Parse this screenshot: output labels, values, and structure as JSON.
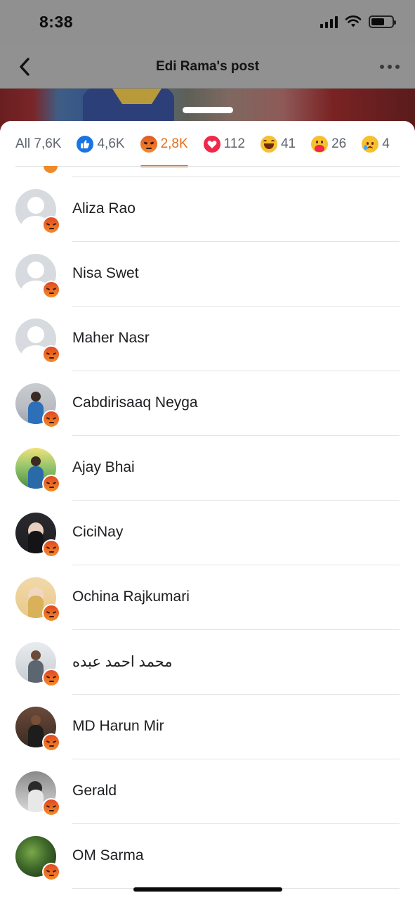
{
  "status_bar": {
    "time": "8:38",
    "icons": [
      "cellular-signal-icon",
      "wifi-icon",
      "battery-icon"
    ]
  },
  "header": {
    "title": "Edi Rama's post",
    "back_icon": "chevron-left-icon",
    "more_icon": "ellipsis-icon"
  },
  "tabs": [
    {
      "label": "All 7,6K",
      "icon": null,
      "active": false
    },
    {
      "label": "4,6K",
      "icon": "like-icon",
      "active": false
    },
    {
      "label": "2,8K",
      "icon": "angry-icon",
      "active": true
    },
    {
      "label": "112",
      "icon": "love-icon",
      "active": false
    },
    {
      "label": "41",
      "icon": "haha-icon",
      "active": false
    },
    {
      "label": "26",
      "icon": "care-icon",
      "active": false
    },
    {
      "label": "4",
      "icon": "sad-icon",
      "active": false
    }
  ],
  "colors": {
    "accent": "#e46d1c",
    "like": "#1b74e4",
    "love": "#f0284a",
    "text": "#1c1e21",
    "muted": "#5f656e"
  },
  "people": [
    {
      "name": "Aliza Rao",
      "avatar": "default"
    },
    {
      "name": "Nisa Swet",
      "avatar": "default"
    },
    {
      "name": "Maher Nasr",
      "avatar": "default"
    },
    {
      "name": "Cabdirisaaq Neyga",
      "avatar": "photo"
    },
    {
      "name": "Ajay Bhai",
      "avatar": "photo"
    },
    {
      "name": "CiciNay",
      "avatar": "photo"
    },
    {
      "name": "Ochina Rajkumari",
      "avatar": "photo"
    },
    {
      "name": "محمد احمد عبده",
      "avatar": "photo"
    },
    {
      "name": "MD Harun Mir",
      "avatar": "photo"
    },
    {
      "name": "Gerald",
      "avatar": "photo"
    },
    {
      "name": "OM Sarma",
      "avatar": "photo"
    }
  ]
}
